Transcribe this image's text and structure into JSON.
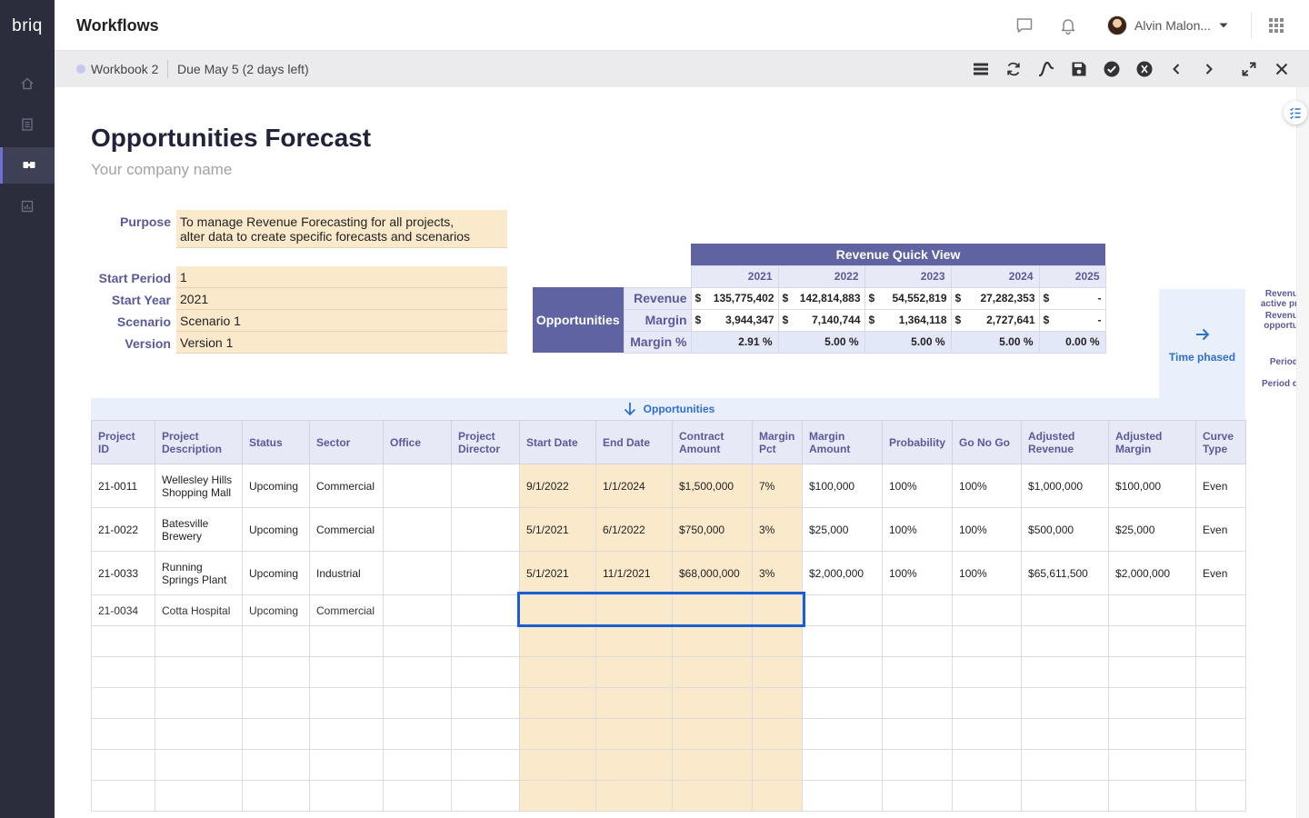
{
  "app": {
    "logo": "briq",
    "title": "Workflows"
  },
  "user": {
    "name": "Alvin Malon..."
  },
  "workbook": {
    "name": "Workbook 2",
    "due": "Due May 5 (2 days left)"
  },
  "rail_icons": [
    "home-icon",
    "document-icon",
    "workflows-icon",
    "reports-icon"
  ],
  "toolbar_icons": [
    "list-icon",
    "refresh-icon",
    "formula-icon",
    "save-icon",
    "check-icon",
    "info-icon",
    "chevron-left-icon",
    "chevron-right-icon",
    "expand-icon",
    "close-icon"
  ],
  "page": {
    "title": "Opportunities Forecast",
    "company": "Your company name"
  },
  "form": {
    "purpose_label": "Purpose",
    "purpose_line1": "To manage Revenue Forecasting for all projects,",
    "purpose_line2": "alter data to create specific forecasts and scenarios",
    "fields": [
      {
        "label": "Start Period",
        "value": "1"
      },
      {
        "label": "Start Year",
        "value": "2021"
      },
      {
        "label": "Scenario",
        "value": "Scenario 1"
      },
      {
        "label": "Version",
        "value": "Version 1"
      }
    ]
  },
  "quick_view": {
    "title": "Revenue Quick View",
    "group_label": "Opportunities",
    "years": [
      "2021",
      "2022",
      "2023",
      "2024",
      "2025"
    ],
    "rows": [
      {
        "label": "Revenue",
        "values": [
          "135,775,402",
          "142,814,883",
          "54,552,819",
          "27,282,353",
          "-"
        ]
      },
      {
        "label": "Margin",
        "values": [
          "3,944,347",
          "7,140,744",
          "1,364,118",
          "2,727,641",
          "-"
        ]
      },
      {
        "label": "Margin %",
        "values": [
          "2.91 %",
          "5.00 %",
          "5.00 %",
          "5.00 %",
          "0.00 %"
        ]
      }
    ],
    "currency": "$"
  },
  "time_phased": {
    "label": "Time phased"
  },
  "right_notes": [
    "Revenu",
    "active pr",
    "Revenu",
    "opportu",
    "Period",
    "Period q"
  ],
  "banner": {
    "label": "Opportunities"
  },
  "grid": {
    "columns": [
      "Project ID",
      "Project Description",
      "Status",
      "Sector",
      "Office",
      "Project Director",
      "Start Date",
      "End Date",
      "Contract Amount",
      "Margin Pct",
      "Margin Amount",
      "Probability",
      "Go No Go",
      "Adjusted Revenue",
      "Adjusted Margin",
      "Curve Type"
    ],
    "rows": [
      [
        "21-0011",
        "Wellesley Hills Shopping Mall",
        "Upcoming",
        "Commercial",
        "",
        "",
        "9/1/2022",
        "1/1/2024",
        "$1,500,000",
        "7%",
        "$100,000",
        "100%",
        "100%",
        "$1,000,000",
        "$100,000",
        "Even"
      ],
      [
        "21-0022",
        "Batesville Brewery",
        "Upcoming",
        "Commercial",
        "",
        "",
        "5/1/2021",
        "6/1/2022",
        "$750,000",
        "3%",
        "$25,000",
        "100%",
        "100%",
        "$500,000",
        "$25,000",
        "Even"
      ],
      [
        "21-0033",
        "Running Springs Plant",
        "Upcoming",
        "Industrial",
        "",
        "",
        "5/1/2021",
        "11/1/2021",
        "$68,000,000",
        "3%",
        "$2,000,000",
        "100%",
        "100%",
        "$65,611,500",
        "$2,000,000",
        "Even"
      ],
      [
        "21-0034",
        "Cotta Hospital",
        "Upcoming",
        "Commercial",
        "",
        "",
        "",
        "",
        "",
        "",
        "",
        "",
        "",
        "",
        "",
        ""
      ]
    ]
  },
  "colors": {
    "rail": "#2b2c3c",
    "accent": "#5f63a2",
    "input_fill": "#fbe9cb",
    "selection": "#1a5fd1",
    "link": "#2f6fd1"
  }
}
